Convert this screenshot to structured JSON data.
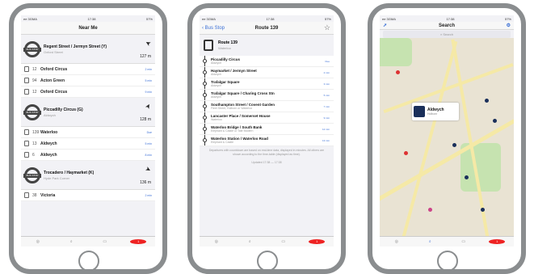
{
  "p1": {
    "status": {
      "carrier": "ee 3GMA",
      "time": "17:38",
      "battery": "57%"
    },
    "title": "Near Me",
    "stops": [
      {
        "name": "Regent Street / Jermyn Street (Y)",
        "sub": "Oxford Street",
        "dist": "127 m",
        "arrow": "➤",
        "rows": [
          {
            "num": "12",
            "dest": "Oxford Circus",
            "time": "2 min"
          },
          {
            "num": "94",
            "dest": "Acton Green",
            "time": "5 min"
          },
          {
            "num": "12",
            "dest": "Oxford Circus",
            "time": "9 min"
          }
        ]
      },
      {
        "name": "Piccadilly Circus (G)",
        "sub": "Aldwych",
        "dist": "128 m",
        "arrow": "➤",
        "rows": [
          {
            "num": "139",
            "dest": "Waterloo",
            "time": "Due"
          },
          {
            "num": "13",
            "dest": "Aldwych",
            "time": "5 min"
          },
          {
            "num": "6",
            "dest": "Aldwych",
            "time": "8 min"
          }
        ]
      },
      {
        "name": "Trocadero / Haymarket (K)",
        "sub": "Hyde Park Corner",
        "dist": "136 m",
        "arrow": "➤",
        "rows": [
          {
            "num": "38",
            "dest": "Victoria",
            "time": "2 min"
          }
        ]
      }
    ],
    "roundel_text": "BUS STOP",
    "tabs": [
      "Near Me",
      "Search",
      "Routes",
      "1"
    ]
  },
  "p2": {
    "status": {
      "carrier": "ee 3GMA",
      "time": "17:38",
      "battery": "57%"
    },
    "back": "Bus Stop",
    "title": "Route 139",
    "star": "☆",
    "route_name": "Route 139",
    "route_sub": "Waterloo",
    "stops": [
      {
        "name": "Piccadilly Circus",
        "sub": "Aldwych",
        "time": "Due"
      },
      {
        "name": "Haymarket / Jermyn Street",
        "sub": "Aldwych",
        "time": "2 min"
      },
      {
        "name": "Trafalgar Square",
        "sub": "Aldwych",
        "time": "3 min"
      },
      {
        "name": "Trafalgar Square / Charing Cross Stn",
        "sub": "Aldwych",
        "time": "5 min"
      },
      {
        "name": "Southampton Street / Covent Garden",
        "sub": "Fleet Street, Holborn or Waterloo",
        "time": "7 min"
      },
      {
        "name": "Lancaster Place / Somerset House",
        "sub": "Waterloo",
        "time": "9 min"
      },
      {
        "name": "Waterloo Bridge / South Bank",
        "sub": "Elephant & Castle or Tate Modern",
        "time": "12 min"
      },
      {
        "name": "Waterloo Station / Waterloo Road",
        "sub": "Elephant & Castle",
        "time": "13 min"
      }
    ],
    "note": "Departures with countdown are based on real-time data, displayed in minutes. All others are shown according to the time-table (displayed as time).",
    "updated": "Updated 17:38 — 17:38",
    "tabs": [
      "Near Me",
      "Search",
      "Routes",
      "1"
    ]
  },
  "p3": {
    "status": {
      "carrier": "ee 3GMA",
      "time": "17:38",
      "battery": "57%"
    },
    "title": "Search",
    "search_placeholder": "Search",
    "callout_title": "Aldwych",
    "callout_sub": "Holborn",
    "tabs": [
      "Near Me",
      "Search",
      "Routes",
      "1"
    ]
  }
}
